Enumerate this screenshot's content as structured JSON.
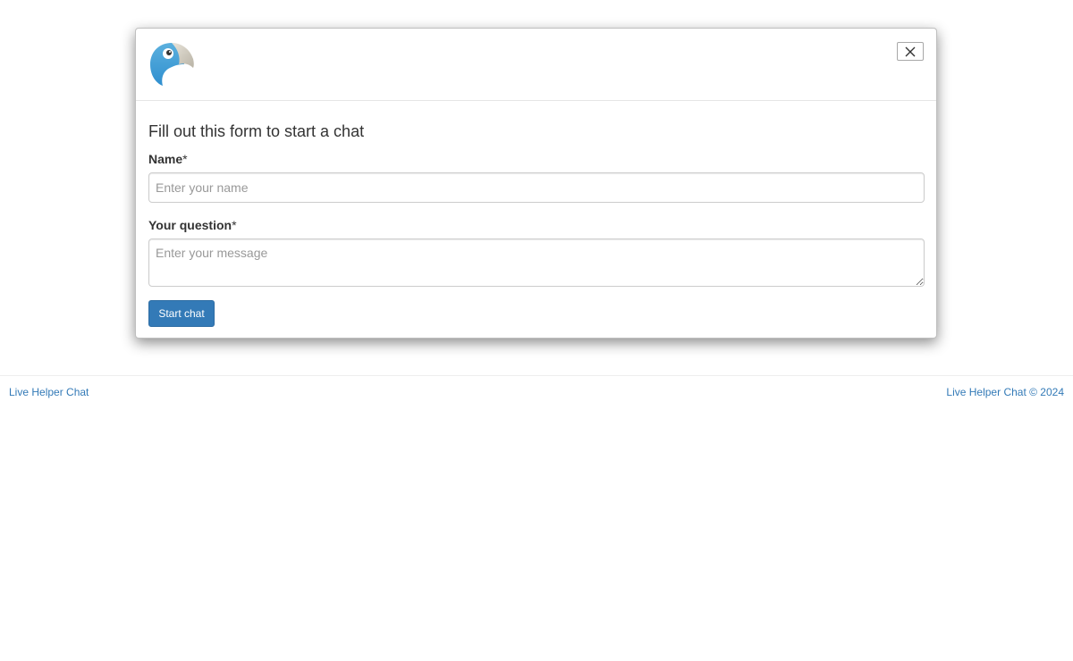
{
  "modal": {
    "logo_icon": "parrot-logo-icon",
    "close_icon": "close-icon",
    "form_title": "Fill out this form to start a chat",
    "name_field": {
      "label": "Name",
      "required_mark": "*",
      "placeholder": "Enter your name",
      "value": ""
    },
    "question_field": {
      "label": "Your question",
      "required_mark": "*",
      "placeholder": "Enter your message",
      "value": ""
    },
    "start_button_label": "Start chat",
    "accent_color": "#337ab7"
  },
  "footer": {
    "left_link": "Live Helper Chat",
    "right_link": "Live Helper Chat © 2024"
  }
}
